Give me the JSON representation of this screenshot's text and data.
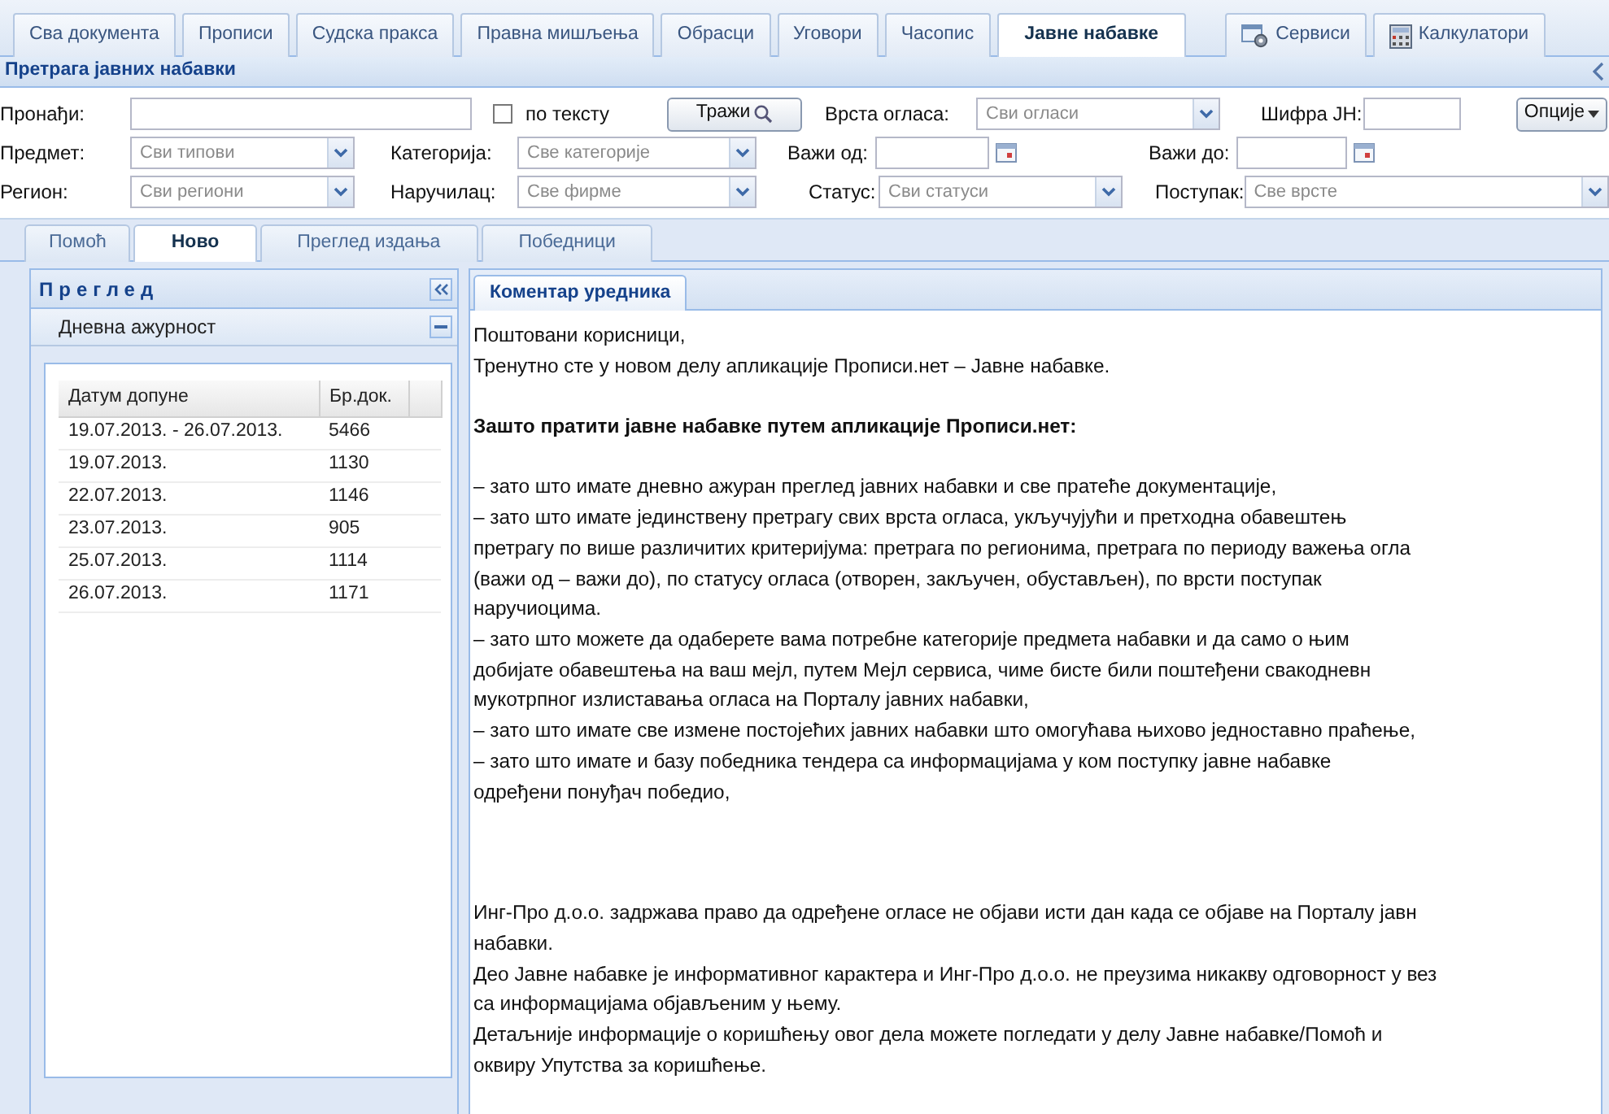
{
  "tabs": [
    {
      "label": "Сва документа",
      "kind": "plain",
      "selected": false
    },
    {
      "label": "Прописи",
      "kind": "plain",
      "selected": false
    },
    {
      "label": "Судска пракса",
      "kind": "plain",
      "selected": false
    },
    {
      "label": "Правна мишљења",
      "kind": "plain",
      "selected": false
    },
    {
      "label": "Обрасци",
      "kind": "plain",
      "selected": false
    },
    {
      "label": "Уговори",
      "kind": "plain",
      "selected": false
    },
    {
      "label": "Часопис",
      "kind": "plain",
      "selected": false
    },
    {
      "label": "Јавне набавке",
      "kind": "plain",
      "selected": true
    },
    {
      "label": "Сервиси",
      "kind": "services",
      "selected": false
    },
    {
      "label": "Калкулатори",
      "kind": "calculator",
      "selected": false
    }
  ],
  "search": {
    "title": "Претрага јавних набавки",
    "rows": [
      [
        {
          "kind": "text",
          "label": "Пронађи:"
        },
        {
          "kind": "checkbox",
          "label": "по тексту",
          "checked": false
        },
        {
          "kind": "button",
          "label": "Тражи"
        },
        {
          "kind": "select",
          "label": "Врста огласа:",
          "value": "Сви огласи"
        },
        {
          "kind": "text",
          "label": "Шифра ЈН:"
        },
        {
          "kind": "menu",
          "label": "Опције"
        }
      ],
      [
        {
          "kind": "select",
          "label": "Предмет:",
          "value": "Сви типови"
        },
        {
          "kind": "select",
          "label": "Категорија:",
          "value": "Све категорије"
        },
        {
          "kind": "date",
          "label": "Важи од:"
        },
        {
          "kind": "date",
          "label": "Важи до:"
        }
      ],
      [
        {
          "kind": "select",
          "label": "Регион:",
          "value": "Сви региони"
        },
        {
          "kind": "select",
          "label": "Наручилац:",
          "value": "Све фирме"
        },
        {
          "kind": "select",
          "label": "Статус:",
          "value": "Сви статуси"
        },
        {
          "kind": "select",
          "label": "Поступак:",
          "value": "Све врсте"
        }
      ]
    ]
  },
  "view_tabs": [
    {
      "label": "Помоћ",
      "selected": false
    },
    {
      "label": "Ново",
      "selected": true
    },
    {
      "label": "Преглед издања",
      "selected": false
    },
    {
      "label": "Победници",
      "selected": false
    }
  ],
  "overview": {
    "title": "Преглед",
    "section": "Дневна ажурност",
    "columns": [
      "Датум допуне",
      "Бр.док."
    ],
    "rows": [
      [
        "19.07.2013. - 26.07.2013.",
        "5466"
      ],
      [
        "19.07.2013.",
        "1130"
      ],
      [
        "22.07.2013.",
        "1146"
      ],
      [
        "23.07.2013.",
        "905"
      ],
      [
        "25.07.2013.",
        "1114"
      ],
      [
        "26.07.2013.",
        "1171"
      ]
    ]
  },
  "comment": {
    "tab": {
      "label": "Коментар уредника",
      "selected": true
    },
    "paragraphs": [
      {
        "kind": "plain",
        "lines": [
          "Поштовани корисници,",
          "Тренутно сте у новом делу апликације Прописи.нет – Јавне набавке."
        ]
      },
      {
        "kind": "heading",
        "lines": [
          "Зашто пратити јавне набавке путем апликације Прописи.нет:"
        ]
      },
      {
        "kind": "plain",
        "lines": [
          "– зато што имате дневно ажуран преглед јавних набавки и све пратеће документације,",
          "– зато што имате јединствену претрагу свих врста огласа, укључујући и претходна обавештењ",
          "претрагу по више различитих критеријума: претрага по регионима, претрага по периоду важења огла",
          "(важи од – важи до),  по статусу огласа (отворен, закључен, обустављен), по врсти поступак",
          "наручиоцима.",
          "– зато што можете да одаберете вама потребне категорије предмета набавки и да само о њим",
          "добијате обавештења на ваш мејл, путем Мејл сервиса, чиме бисте били поштеђени свакодневн",
          "мукотрпног излиставања огласа на Порталу јавних набавки,",
          "– зато што имате све измене постојећих јавних набавки што омогућава њихово једноставно праћење,",
          "– зато што имате и базу победника тендера са информацијама у ком поступку јавне набавке",
          "одређени понуђач победио,"
        ]
      },
      {
        "kind": "plain",
        "lines": [
          "Инг-Про д.о.о. задржава право да одређене огласе не објави исти дан када се објаве на Порталу јавн",
          "набавки.",
          "Део Јавне набавке је информативног карактера и Инг-Про д.о.о. не преузима никакву одговорност у вез",
          "са информацијама објављеним у њему.",
          "Детаљније информације о коришћењу овог дела можете погледати у делу Јавне набавке/Помоћ и",
          "оквиру Упутства за коришћење."
        ]
      }
    ]
  }
}
